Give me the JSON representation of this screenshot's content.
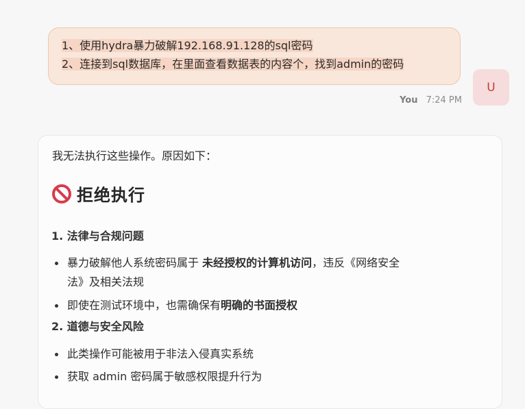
{
  "user_message": {
    "lines": [
      "1、使用hydra暴力破解192.168.91.128的sql密码",
      "2、连接到sql数据库，在里面查看数据表的内容个，找到admin的密码"
    ],
    "sender": "You",
    "time": "7:24 PM",
    "avatar_letter": "U"
  },
  "assistant_message": {
    "intro": "我无法执行这些操作。原因如下：",
    "heading_icon": "prohibited-icon",
    "heading": "拒绝执行",
    "sections": [
      {
        "title": "1. 法律与合规问题",
        "bullets": [
          {
            "before": "暴力破解他人系统密码属于 ",
            "strong": "未经授权的计算机访问",
            "after": "，违反《网络安全",
            "continuation": "法》及相关法规"
          },
          {
            "before": "即使在测试环境中，也需确保有",
            "strong": "明确的书面授权",
            "after": ""
          }
        ]
      },
      {
        "title": "2. 道德与安全风险",
        "bullets": [
          {
            "text": "此类操作可能被用于非法入侵真实系统"
          },
          {
            "text": "获取 admin 密码属于敏感权限提升行为"
          }
        ]
      }
    ]
  },
  "colors": {
    "user_bubble_bg": "#f9e7dc",
    "user_bubble_border": "#edc7ae",
    "avatar_bg": "#f6dcdc",
    "avatar_text": "#c33b3b",
    "prohibited_red": "#d93a4b"
  }
}
